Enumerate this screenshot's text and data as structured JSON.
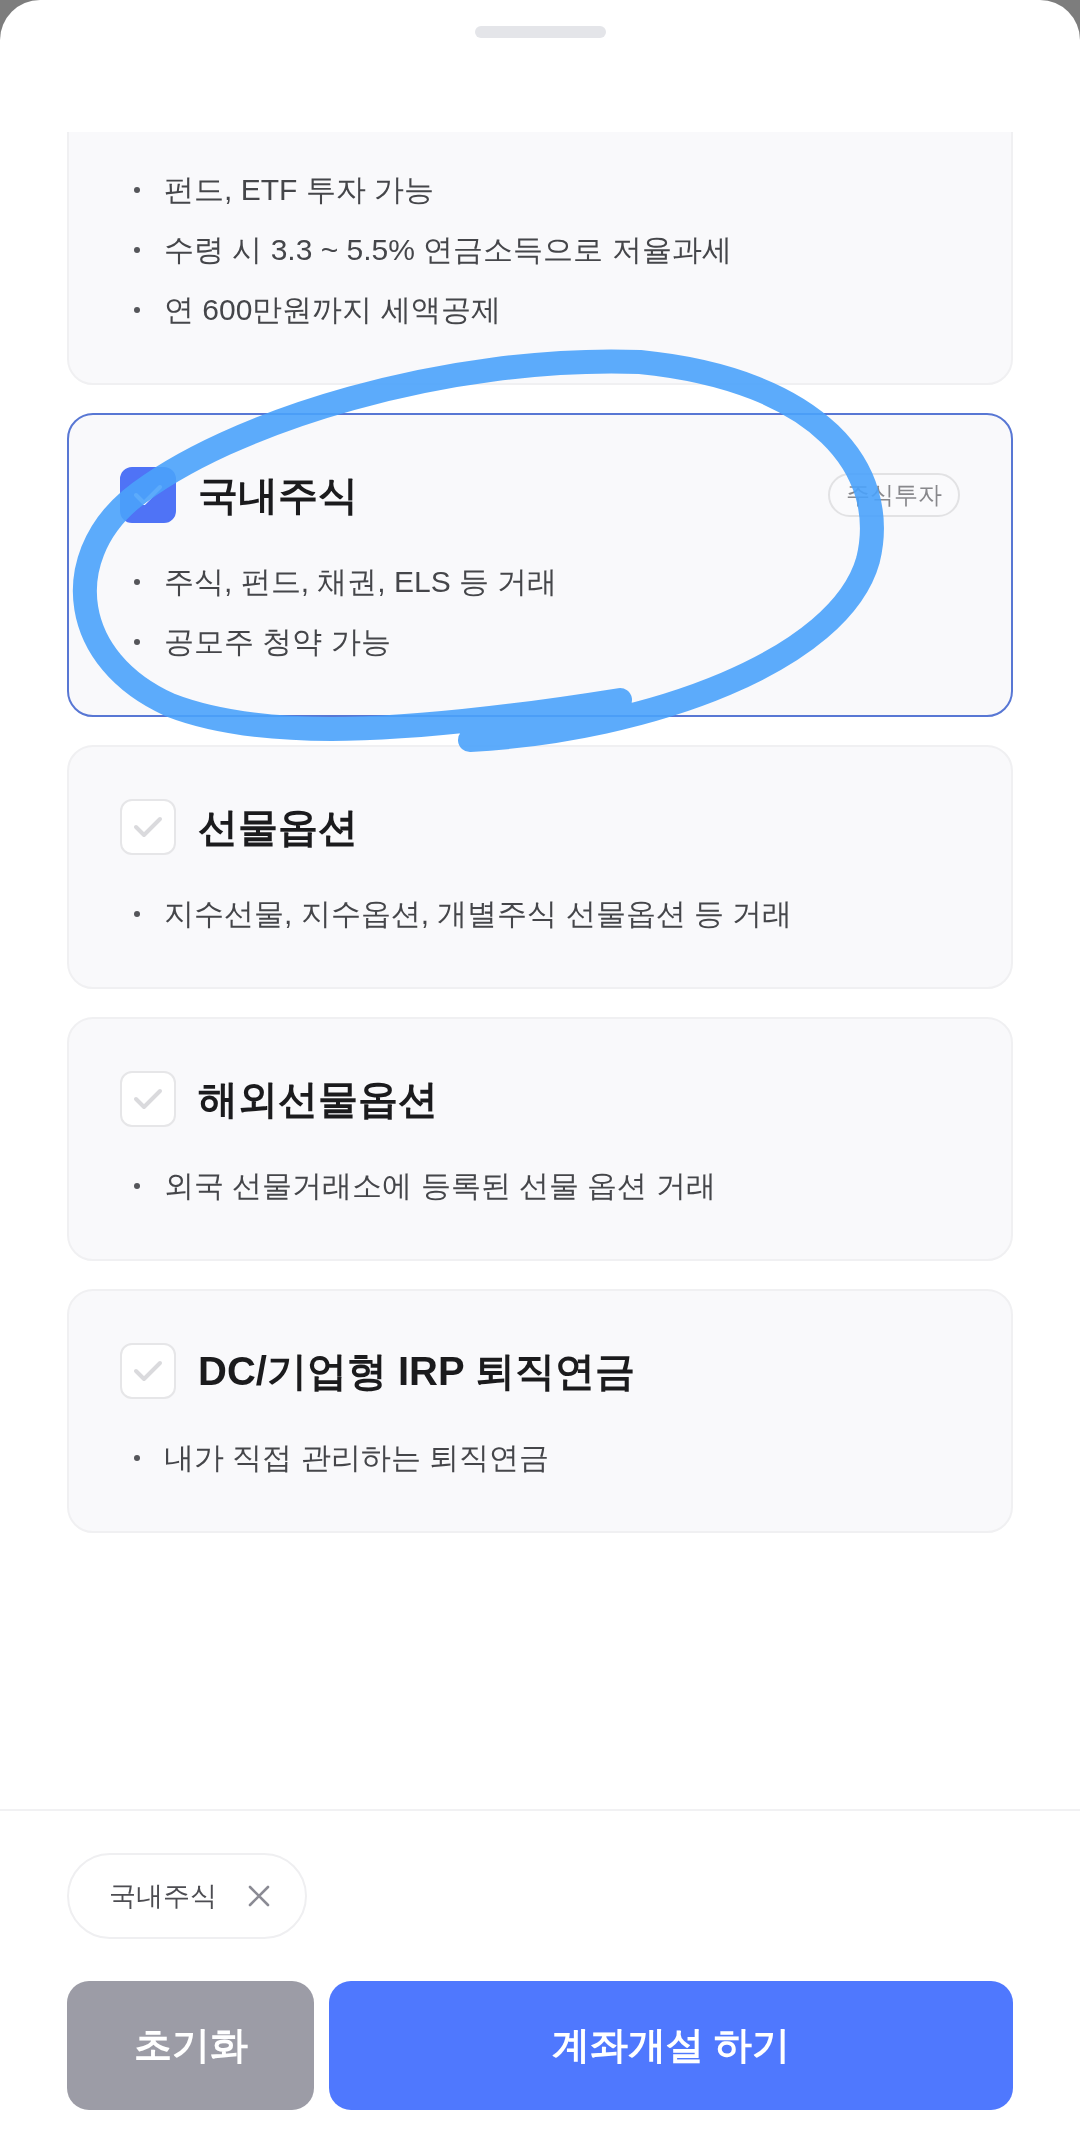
{
  "products": [
    {
      "bullets": [
        "펀드, ETF 투자 가능",
        "수령 시 3.3 ~ 5.5% 연금소득으로 저율과세",
        "연 600만원까지 세액공제"
      ]
    },
    {
      "title": "국내주식",
      "checked": true,
      "tag": "주식투자",
      "bullets": [
        "주식, 펀드, 채권, ELS 등 거래",
        "공모주 청약 가능"
      ]
    },
    {
      "title": "선물옵션",
      "checked": false,
      "bullets": [
        "지수선물, 지수옵션, 개별주식 선물옵션 등 거래"
      ]
    },
    {
      "title": "해외선물옵션",
      "checked": false,
      "bullets": [
        "외국 선물거래소에 등록된 선물 옵션 거래"
      ]
    },
    {
      "title": "DC/기업형 IRP 퇴직연금",
      "checked": false,
      "bullets": [
        "내가 직접 관리하는 퇴직연금"
      ]
    }
  ],
  "selected_chips": [
    {
      "label": "국내주식"
    }
  ],
  "buttons": [
    {
      "label": "초기화",
      "kind": "secondary"
    },
    {
      "label": "계좌개설 하기",
      "kind": "primary"
    }
  ]
}
